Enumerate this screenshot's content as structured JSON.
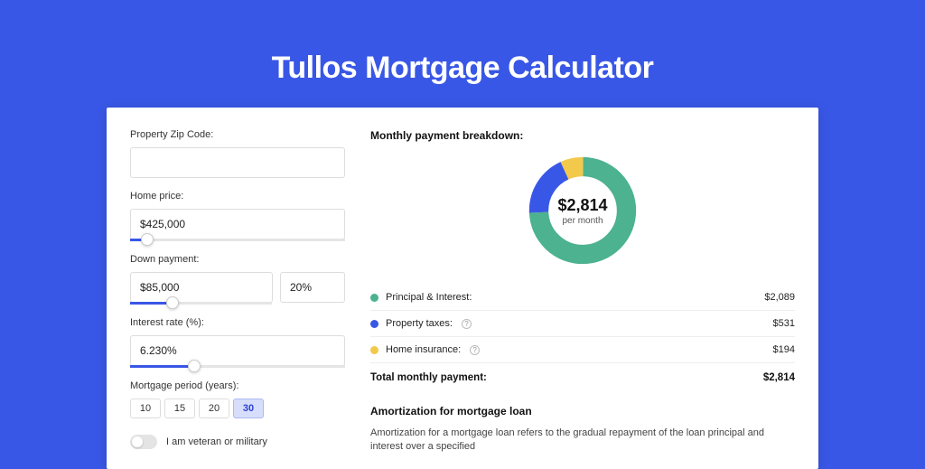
{
  "title": "Tullos Mortgage Calculator",
  "colors": {
    "accent": "#3957e6",
    "principal": "#4cb28f",
    "taxes": "#3957e6",
    "insurance": "#f3c94c"
  },
  "form": {
    "zip": {
      "label": "Property Zip Code:",
      "value": ""
    },
    "price": {
      "label": "Home price:",
      "value": "$425,000",
      "slider_pct": 8
    },
    "down": {
      "label": "Down payment:",
      "amount": "$85,000",
      "percent": "20%",
      "slider_pct": 20
    },
    "rate": {
      "label": "Interest rate (%):",
      "value": "6.230%",
      "slider_pct": 30
    },
    "period": {
      "label": "Mortgage period (years):",
      "options": [
        "10",
        "15",
        "20",
        "30"
      ],
      "selected": "30"
    },
    "veteran": {
      "label": "I am veteran or military",
      "checked": false
    }
  },
  "breakdown": {
    "title": "Monthly payment breakdown:",
    "center_amount": "$2,814",
    "center_sub": "per month",
    "items": [
      {
        "label": "Principal & Interest:",
        "value": "$2,089",
        "color": "#4cb28f",
        "info": false
      },
      {
        "label": "Property taxes:",
        "value": "$531",
        "color": "#3957e6",
        "info": true
      },
      {
        "label": "Home insurance:",
        "value": "$194",
        "color": "#f3c94c",
        "info": true
      }
    ],
    "total_label": "Total monthly payment:",
    "total_value": "$2,814"
  },
  "amortization": {
    "title": "Amortization for mortgage loan",
    "body": "Amortization for a mortgage loan refers to the gradual repayment of the loan principal and interest over a specified"
  },
  "chart_data": {
    "type": "pie",
    "title": "Monthly payment breakdown",
    "series": [
      {
        "name": "Principal & Interest",
        "value": 2089,
        "color": "#4cb28f"
      },
      {
        "name": "Property taxes",
        "value": 531,
        "color": "#3957e6"
      },
      {
        "name": "Home insurance",
        "value": 194,
        "color": "#f3c94c"
      }
    ],
    "total": 2814,
    "unit": "USD per month"
  }
}
